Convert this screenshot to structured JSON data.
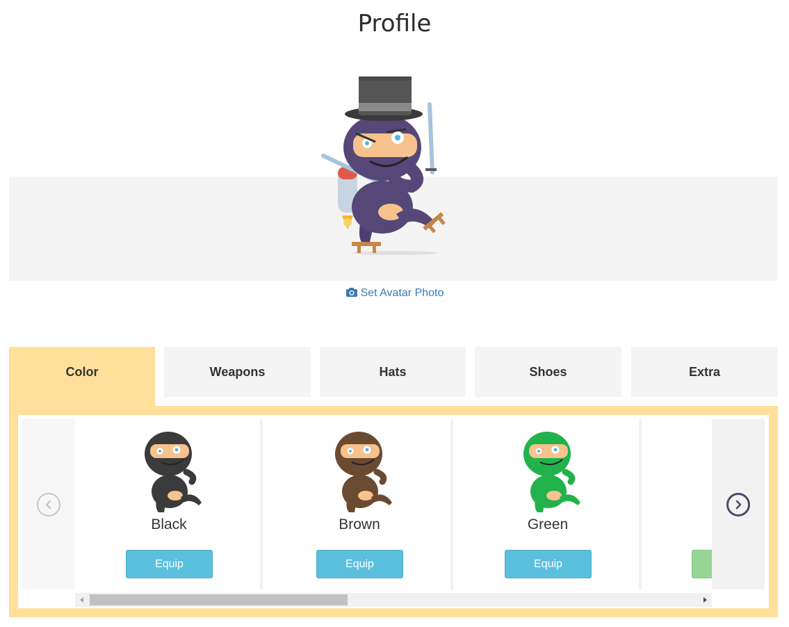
{
  "page": {
    "title": "Profile"
  },
  "hero": {
    "avatar_icon": "ninja-top-hat-jetpack-avatar",
    "set_avatar_label": "Set Avatar Photo",
    "set_avatar_icon": "camera-icon"
  },
  "tabs": [
    {
      "label": "Color",
      "active": true
    },
    {
      "label": "Weapons",
      "active": false
    },
    {
      "label": "Hats",
      "active": false
    },
    {
      "label": "Shoes",
      "active": false
    },
    {
      "label": "Extra",
      "active": false
    }
  ],
  "carousel": {
    "prev_icon": "chevron-left-icon",
    "next_icon": "chevron-right-icon",
    "items": [
      {
        "name": "Black",
        "button_label": "Equip",
        "color": "#3b3b3b"
      },
      {
        "name": "Brown",
        "button_label": "Equip",
        "color": "#6b4a32"
      },
      {
        "name": "Green",
        "button_label": "Equip",
        "color": "#22b24c"
      }
    ],
    "equipped_button_color": "#96d595",
    "scroll_position": 0.0
  },
  "colors": {
    "active_tab": "#ffe09b",
    "equip_button": "#5bbfde",
    "link": "#3a78b6"
  }
}
